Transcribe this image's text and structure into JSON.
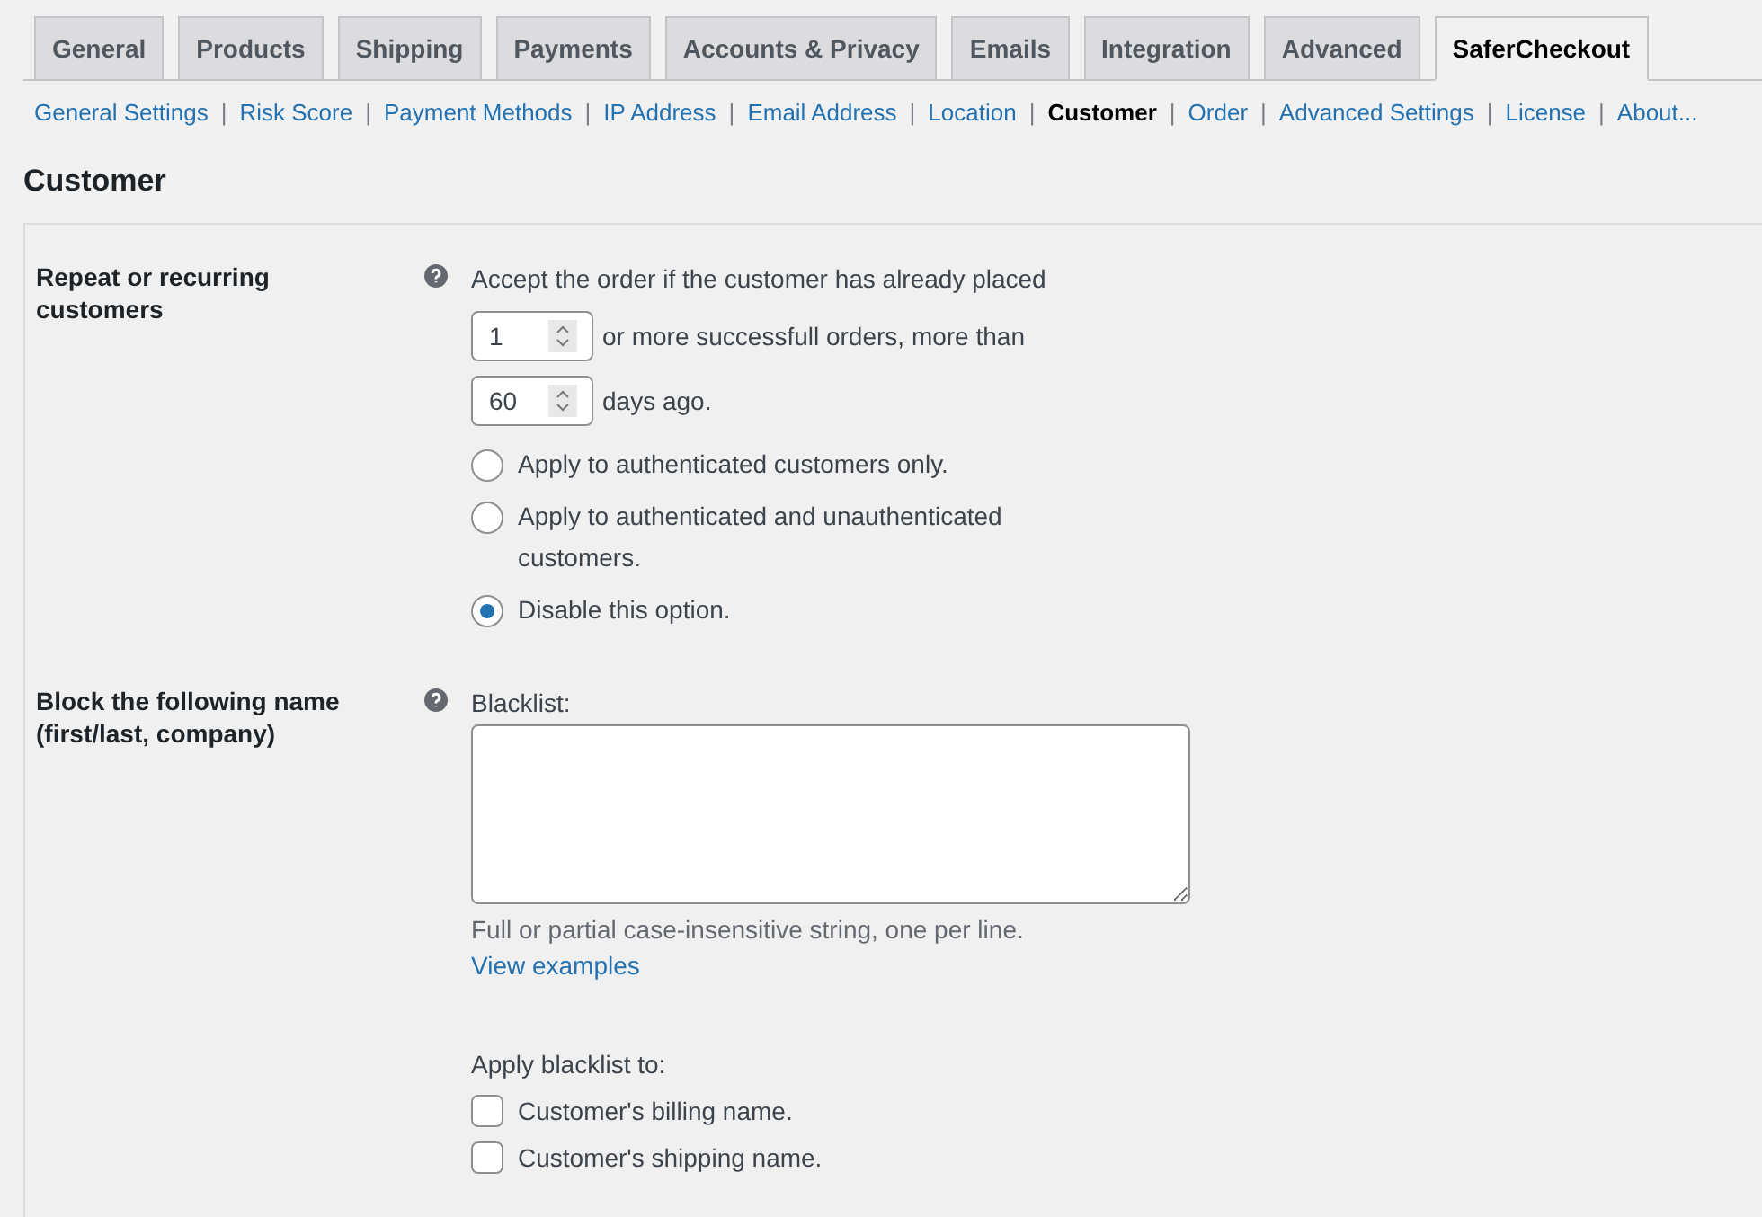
{
  "tabs": [
    {
      "label": "General",
      "selected": false
    },
    {
      "label": "Products",
      "selected": false
    },
    {
      "label": "Shipping",
      "selected": false
    },
    {
      "label": "Payments",
      "selected": false
    },
    {
      "label": "Accounts & Privacy",
      "selected": false
    },
    {
      "label": "Emails",
      "selected": false
    },
    {
      "label": "Integration",
      "selected": false
    },
    {
      "label": "Advanced",
      "selected": false
    },
    {
      "label": "SaferCheckout",
      "selected": true
    }
  ],
  "subnav": [
    {
      "label": "General Settings",
      "selected": false
    },
    {
      "label": "Risk Score",
      "selected": false
    },
    {
      "label": "Payment Methods",
      "selected": false
    },
    {
      "label": "IP Address",
      "selected": false
    },
    {
      "label": "Email Address",
      "selected": false
    },
    {
      "label": "Location",
      "selected": false
    },
    {
      "label": "Customer",
      "selected": true
    },
    {
      "label": "Order",
      "selected": false
    },
    {
      "label": "Advanced Settings",
      "selected": false
    },
    {
      "label": "License",
      "selected": false
    },
    {
      "label": "About...",
      "selected": false
    }
  ],
  "subnav_separator": "|",
  "section_title": "Customer",
  "settings": [
    {
      "kind": "repeat",
      "label": "Repeat or recurring customers",
      "intro": "Accept the order if the customer has already placed",
      "orders_value": "1",
      "orders_text": "or more successfull orders, more than",
      "days_value": "60",
      "days_text": "days ago.",
      "options": [
        {
          "label": "Apply to authenticated customers only.",
          "selected": false
        },
        {
          "label": "Apply to authenticated and unauthenticated customers.",
          "selected": false
        },
        {
          "label": "Disable this option.",
          "selected": true
        }
      ]
    },
    {
      "kind": "blacklist",
      "label": "Block the following name (first/last, company)",
      "field_label": "Blacklist:",
      "hint": "Full or partial case-insensitive string, one per line.",
      "link": "View examples",
      "apply_label": "Apply blacklist to:",
      "checks": [
        {
          "label": "Customer's billing name.",
          "checked": false
        },
        {
          "label": "Customer's shipping name.",
          "checked": false
        }
      ]
    }
  ]
}
